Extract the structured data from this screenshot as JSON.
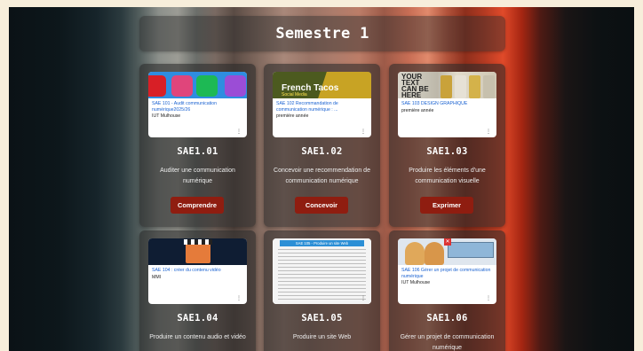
{
  "page": {
    "title": "Semestre 1"
  },
  "colors": {
    "accent_button": "#8f1d10",
    "link_blue": "#1a62d1"
  },
  "cards": [
    {
      "code": "SAE1.01",
      "course_title": "SAE 101 - Audit communication numérique2025/26",
      "course_sub": "IUT Mulhouse",
      "description": "Auditer une communication numérique",
      "button": "Comprendre",
      "menu": "⋮"
    },
    {
      "code": "SAE1.02",
      "course_title": "SAE 102 Recommandation de communication numérique : ...",
      "course_sub": "première année",
      "description": "Concevoir une recommendation de communication numérique",
      "button": "Concevoir",
      "menu": "⋮",
      "image_text": "French Tacos",
      "image_sub": "Social Media"
    },
    {
      "code": "SAE1.03",
      "course_title": "SAE 103 DESIGN GRAPHIQUE",
      "course_sub": "première année",
      "description": "Produire les éléments d'une communication visuelle",
      "button": "Exprimer",
      "menu": "⋮",
      "image_text": "YOUR TEXT CAN BE HERE"
    },
    {
      "code": "SAE1.04",
      "course_title": "SAE 104 : créer du contenu vidéo",
      "course_sub": "MMI",
      "description": "Produire un contenu audio et vidéo",
      "menu": "⋮"
    },
    {
      "code": "SAE1.05",
      "course_title": "SAE 105 - Produire un site Web",
      "course_sub": "",
      "description": "Produire un site Web",
      "menu": "⋮"
    },
    {
      "code": "SAE1.06",
      "course_title": "SAE 106 Gérer un projet de communication numérique",
      "course_sub": "IUT Mulhouse",
      "description": "Gérer un projet de communication numérique",
      "menu": "⋮"
    }
  ]
}
